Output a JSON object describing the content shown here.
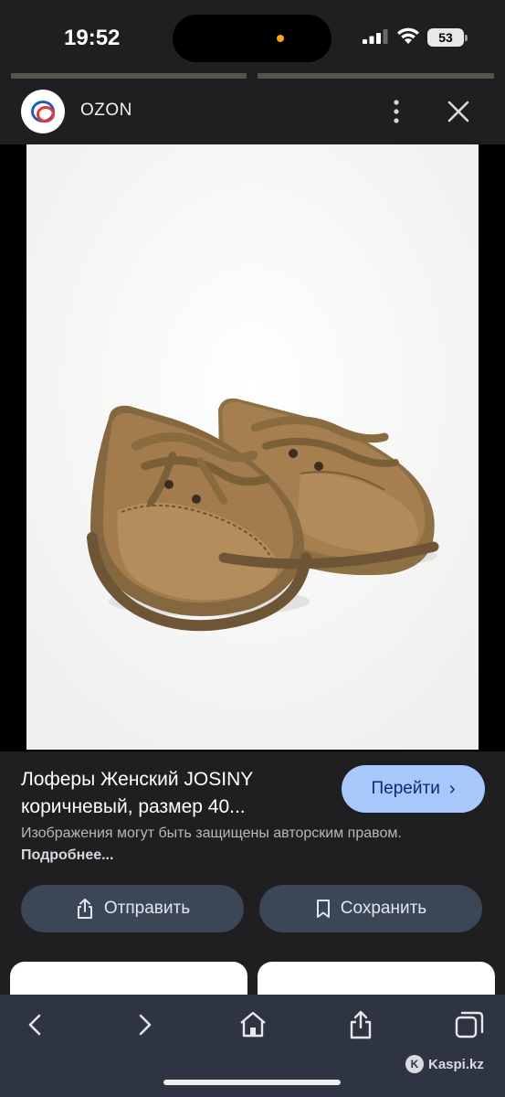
{
  "status_bar": {
    "time": "19:52",
    "battery_level": "53",
    "icons": [
      "signal-icon",
      "wifi-icon",
      "battery-icon"
    ]
  },
  "source": {
    "site_name": "OZON",
    "logo": "ozon-logo",
    "menu_icon": "more-vertical-icon",
    "close_icon": "close-icon"
  },
  "image": {
    "subject": "product-photo"
  },
  "result": {
    "title": "Лоферы Женский JOSINY коричневый, размер 40...",
    "goto_label": "Перейти",
    "goto_icon": "chevron-right-icon",
    "copyright_text": "Изображения могут быть защищены авторским правом.",
    "more_link": "Подробнее..."
  },
  "actions": {
    "share_label": "Отправить",
    "share_icon": "share-icon",
    "save_label": "Сохранить",
    "save_icon": "bookmark-icon"
  },
  "toolbar": {
    "icons": [
      "back-icon",
      "forward-icon",
      "home-icon",
      "share-icon",
      "tabs-icon"
    ]
  },
  "watermark": {
    "text": "Kaspi.kz"
  },
  "colors": {
    "accent_button": "#a8c7fa",
    "secondary_button": "#3b4656",
    "panel": "#1f1f21",
    "toolbar": "#2e3442"
  }
}
